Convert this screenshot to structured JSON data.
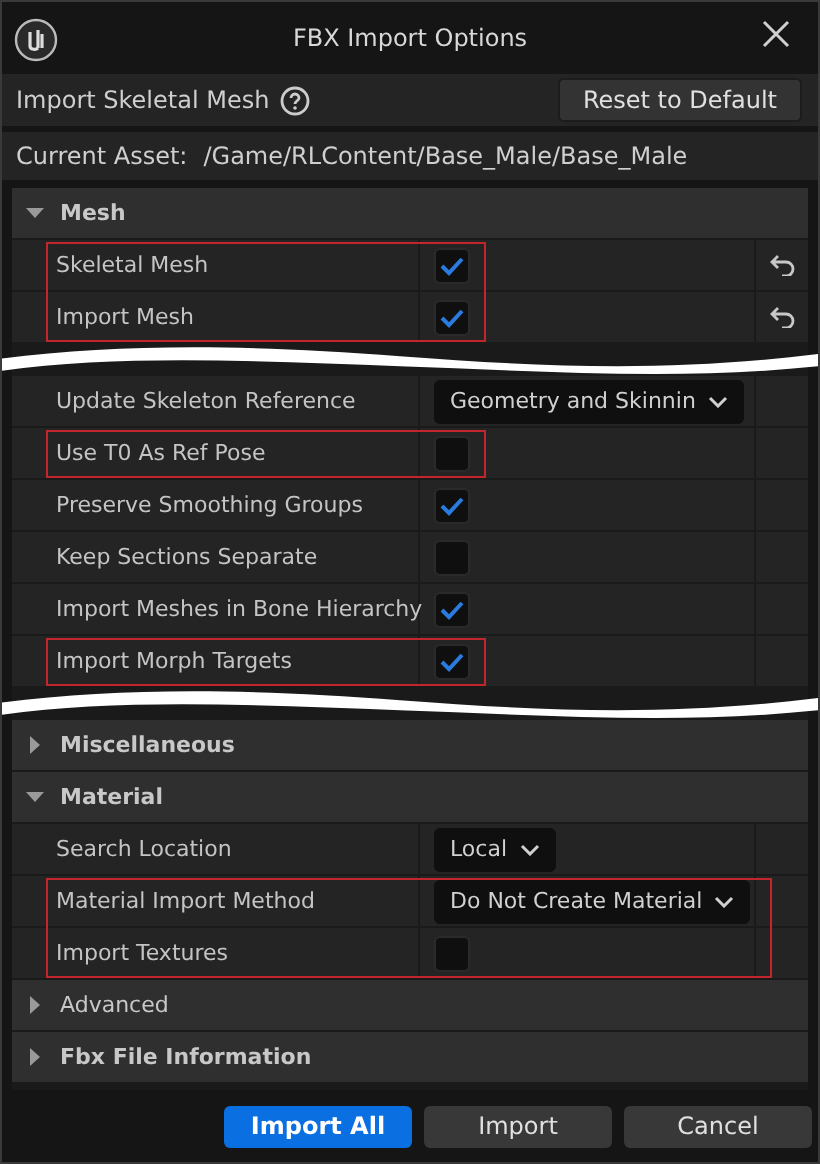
{
  "window": {
    "title": "FBX Import Options"
  },
  "header": {
    "title": "Import Skeletal Mesh",
    "reset_button": "Reset to Default"
  },
  "current_asset": {
    "label": "Current Asset:",
    "path": "/Game/RLContent/Base_Male/Base_Male"
  },
  "sections": [
    {
      "title": "Mesh",
      "expanded": true,
      "blocks": [
        {
          "kind": "group",
          "highlighted": true,
          "rows": [
            {
              "label": "Skeletal Mesh",
              "kind": "checkbox",
              "checked": true,
              "resettable": true
            },
            {
              "label": "Import Mesh",
              "kind": "checkbox",
              "checked": true,
              "resettable": true
            }
          ]
        },
        {
          "kind": "tear"
        },
        {
          "kind": "group",
          "highlighted": false,
          "rows": [
            {
              "label": "Update Skeleton Reference",
              "kind": "dropdown",
              "value": "Geometry and Skinnin",
              "resettable": false
            }
          ]
        },
        {
          "kind": "group",
          "highlighted": true,
          "rows": [
            {
              "label": "Use T0 As Ref Pose",
              "kind": "checkbox",
              "checked": false,
              "resettable": false
            }
          ]
        },
        {
          "kind": "group",
          "highlighted": false,
          "rows": [
            {
              "label": "Preserve Smoothing Groups",
              "kind": "checkbox",
              "checked": true,
              "resettable": false
            },
            {
              "label": "Keep Sections Separate",
              "kind": "checkbox",
              "checked": false,
              "resettable": false
            },
            {
              "label": "Import Meshes in Bone Hierarchy",
              "kind": "checkbox",
              "checked": true,
              "resettable": false
            }
          ]
        },
        {
          "kind": "group",
          "highlighted": true,
          "rows": [
            {
              "label": "Import Morph Targets",
              "kind": "checkbox",
              "checked": true,
              "resettable": false
            }
          ]
        },
        {
          "kind": "tear"
        }
      ]
    },
    {
      "title": "Miscellaneous",
      "expanded": false
    },
    {
      "title": "Material",
      "expanded": true,
      "blocks": [
        {
          "kind": "group",
          "highlighted": false,
          "rows": [
            {
              "label": "Search Location",
              "kind": "dropdown",
              "value": "Local",
              "resettable": false
            }
          ]
        },
        {
          "kind": "group",
          "highlighted": true,
          "rows": [
            {
              "label": "Material Import Method",
              "kind": "dropdown",
              "value": "Do Not Create Material",
              "resettable": false
            },
            {
              "label": "Import Textures",
              "kind": "checkbox",
              "checked": false,
              "resettable": false
            }
          ]
        }
      ]
    },
    {
      "title": "Advanced",
      "expanded": false,
      "bold": false
    },
    {
      "title": "Fbx File Information",
      "expanded": false
    }
  ],
  "buttons": [
    {
      "label": "Import All",
      "primary": true
    },
    {
      "label": "Import",
      "primary": false
    },
    {
      "label": "Cancel",
      "primary": false
    }
  ]
}
